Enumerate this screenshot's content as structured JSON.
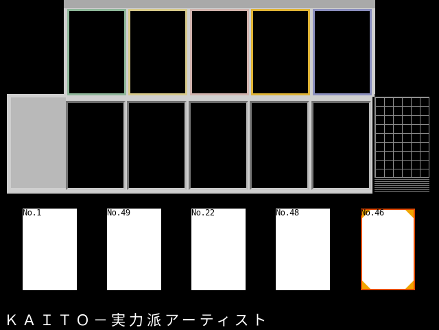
{
  "board": {
    "top_slots": [
      {
        "name": "slot-green",
        "color": "#8fb79a"
      },
      {
        "name": "slot-yellow",
        "color": "#d7c98a"
      },
      {
        "name": "slot-pink",
        "color": "#d1b3ad"
      },
      {
        "name": "slot-gold",
        "color": "#e0b436"
      },
      {
        "name": "slot-blue",
        "color": "#8b8fbe"
      }
    ],
    "bottom_slot_count": 5
  },
  "hand": [
    {
      "number": "No.1",
      "selected": false
    },
    {
      "number": "No.49",
      "selected": false
    },
    {
      "number": "No.22",
      "selected": false
    },
    {
      "number": "No.48",
      "selected": false
    },
    {
      "number": "No.46",
      "selected": true
    }
  ],
  "caption": "ＫＡＩＴＯ－実力派アーティスト",
  "colors": {
    "board": "#cfcfcf",
    "selection_border": "#e24c00",
    "selection_corner": "#f2a400"
  }
}
